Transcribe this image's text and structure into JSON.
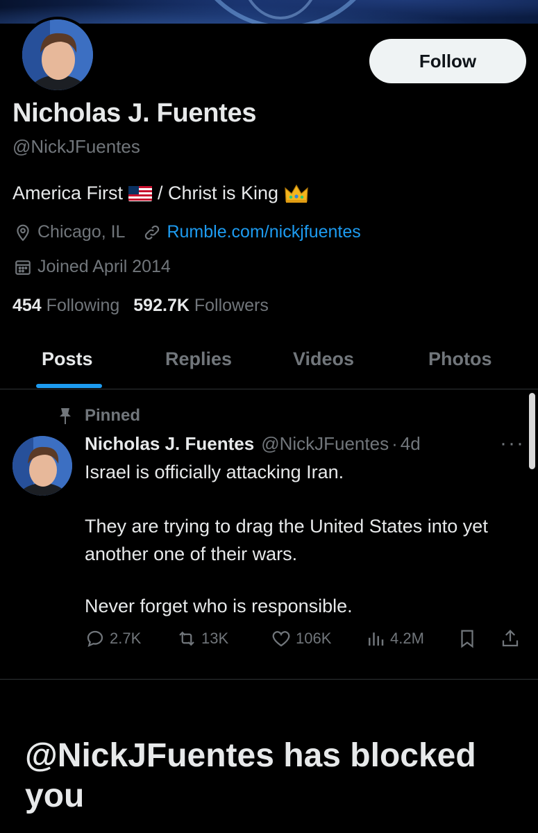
{
  "profile": {
    "name": "Nicholas J. Fuentes",
    "handle": "@NickJFuentes",
    "follow_label": "Follow",
    "bio_part1": "America First",
    "bio_part2": "/ Christ is King",
    "location": "Chicago, IL",
    "website": "Rumble.com/nickjfuentes",
    "joined": "Joined April 2014",
    "following_count": "454",
    "following_label": "Following",
    "followers_count": "592.7K",
    "followers_label": "Followers"
  },
  "tabs": [
    {
      "label": "Posts",
      "active": true
    },
    {
      "label": "Replies",
      "active": false
    },
    {
      "label": "Videos",
      "active": false
    },
    {
      "label": "Photos",
      "active": false
    }
  ],
  "post": {
    "pinned_label": "Pinned",
    "author_name": "Nicholas J. Fuentes",
    "author_handle": "@NickJFuentes",
    "separator": "·",
    "age": "4d",
    "more": "···",
    "lines": [
      "Israel is officially attacking Iran.",
      "They are trying to drag the United States into yet another one of their wars.",
      "Never forget who is responsible."
    ],
    "replies": "2.7K",
    "reposts": "13K",
    "likes": "106K",
    "views": "4.2M"
  },
  "blocked_message": "@NickJFuentes has blocked you",
  "colors": {
    "background": "#000000",
    "text": "#e7e9ea",
    "muted": "#71767b",
    "accent": "#1d9bf0",
    "button_bg": "#eff3f4"
  },
  "icons": [
    "location-icon",
    "link-icon",
    "calendar-icon",
    "pin-icon",
    "reply-icon",
    "repost-icon",
    "like-icon",
    "views-icon",
    "bookmark-icon",
    "share-icon",
    "flag-icon",
    "crown-icon"
  ]
}
